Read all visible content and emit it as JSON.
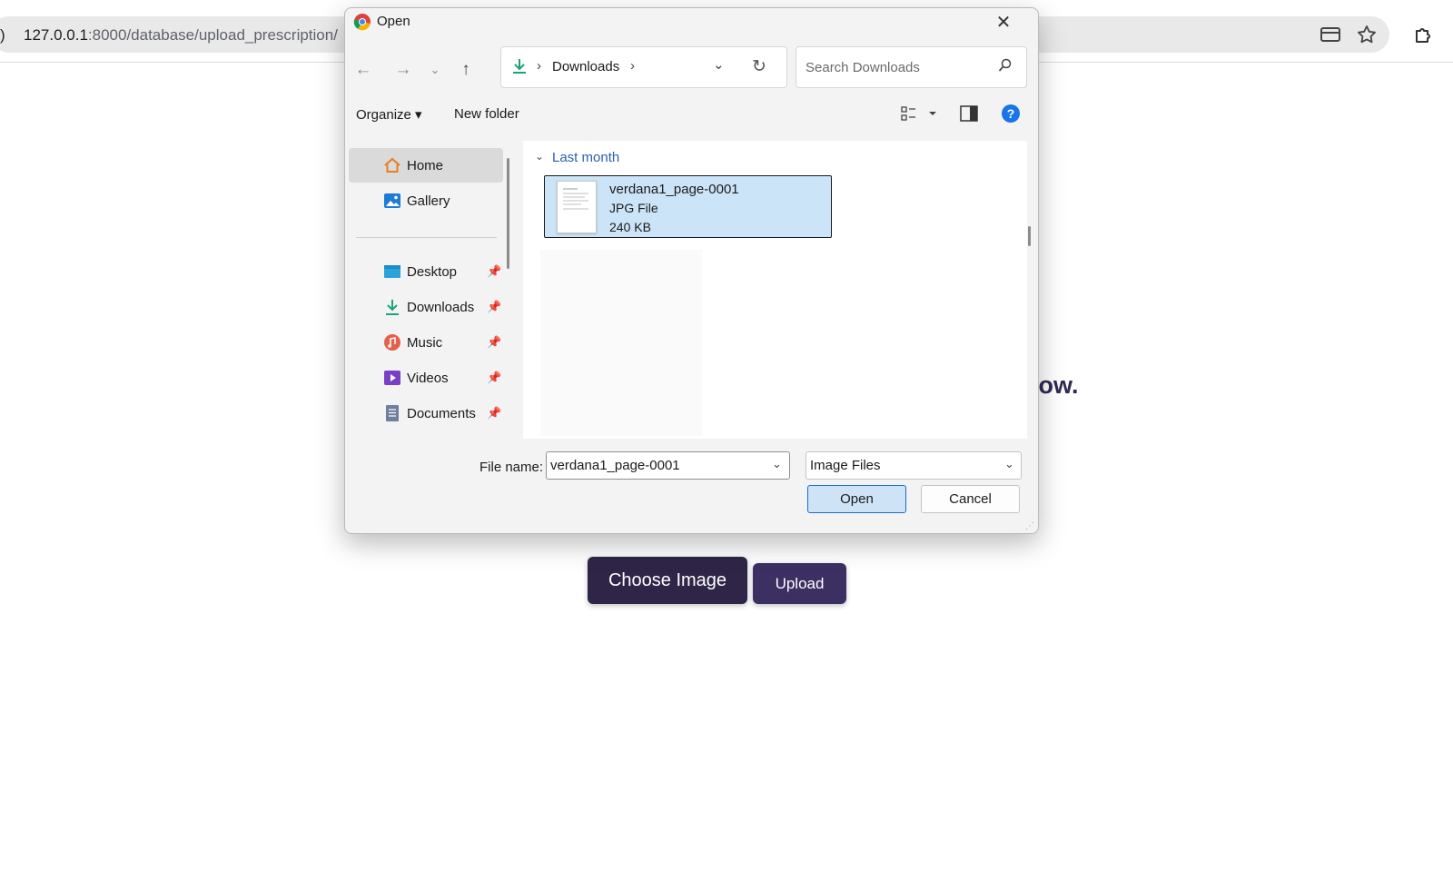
{
  "browser": {
    "url_host": "127.0.0.1",
    "url_path": ":8000/database/upload_prescription/",
    "lead_glyph": ")"
  },
  "page": {
    "heading_fragment": "low.",
    "choose_label": "Choose Image",
    "upload_label": "Upload"
  },
  "dialog": {
    "title": "Open",
    "close_glyph": "✕",
    "address": {
      "location": "Downloads"
    },
    "search_placeholder": "Search Downloads",
    "commands": {
      "organize": "Organize ▾",
      "new_folder": "New folder"
    },
    "help_glyph": "?",
    "nav": [
      {
        "label": "Home",
        "icon": "home-icon"
      },
      {
        "label": "Gallery",
        "icon": "gallery-icon"
      },
      {
        "label": "Desktop",
        "icon": "desktop-icon"
      },
      {
        "label": "Downloads",
        "icon": "downloads-icon"
      },
      {
        "label": "Music",
        "icon": "music-icon"
      },
      {
        "label": "Videos",
        "icon": "videos-icon"
      },
      {
        "label": "Documents",
        "icon": "documents-icon"
      }
    ],
    "group_label": "Last month",
    "file": {
      "name": "verdana1_page-0001",
      "type": "JPG File",
      "size": "240 KB"
    },
    "file_name_label": "File name:",
    "file_name_value": "verdana1_page-0001",
    "file_type_value": "Image Files",
    "open_label": "Open",
    "cancel_label": "Cancel"
  }
}
